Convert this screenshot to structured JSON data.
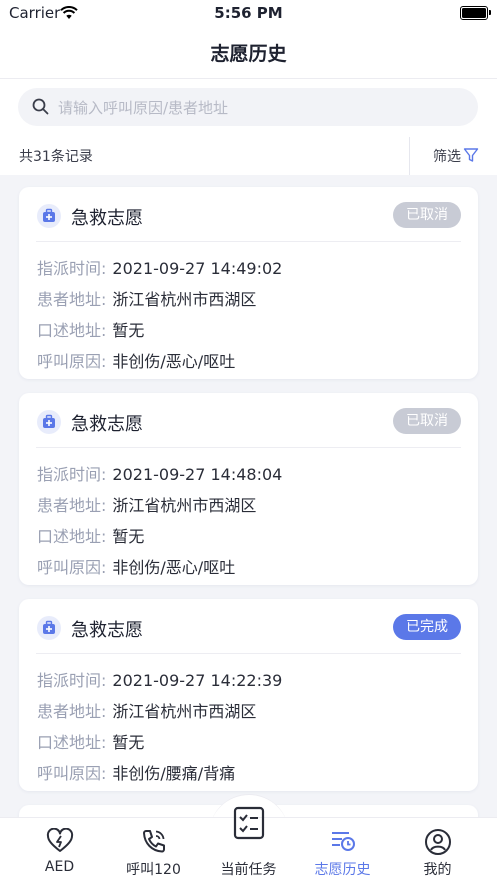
{
  "status_bar": {
    "carrier": "Carrier",
    "time": "5:56 PM"
  },
  "nav": {
    "title": "志愿历史"
  },
  "search": {
    "placeholder": "请输入呼叫原因/患者地址"
  },
  "summary": {
    "count_text": "共31条记录",
    "filter_label": "筛选"
  },
  "labels": {
    "dispatch_time": "指派时间:",
    "patient_address": "患者地址:",
    "oral_address": "口述地址:",
    "call_reason": "呼叫原因:"
  },
  "records": [
    {
      "title": "急救志愿",
      "status": "已取消",
      "status_color": "#c8cbd5",
      "dispatch_time": "2021-09-27 14:49:02",
      "patient_address": "浙江省杭州市西湖区",
      "oral_address": "暂无",
      "call_reason": "非创伤/恶心/呕吐"
    },
    {
      "title": "急救志愿",
      "status": "已取消",
      "status_color": "#c8cbd5",
      "dispatch_time": "2021-09-27 14:48:04",
      "patient_address": "浙江省杭州市西湖区",
      "oral_address": "暂无",
      "call_reason": "非创伤/恶心/呕吐"
    },
    {
      "title": "急救志愿",
      "status": "已完成",
      "status_color": "#5b78e8",
      "dispatch_time": "2021-09-27 14:22:39",
      "patient_address": "浙江省杭州市西湖区",
      "oral_address": "暂无",
      "call_reason": "非创伤/腰痛/背痛"
    }
  ],
  "tabs": [
    {
      "label": "AED",
      "icon": "heart-pulse-icon"
    },
    {
      "label": "呼叫120",
      "icon": "phone-call-icon"
    },
    {
      "label": "当前任务",
      "icon": "task-list-icon"
    },
    {
      "label": "志愿历史",
      "icon": "history-list-icon",
      "active": true
    },
    {
      "label": "我的",
      "icon": "profile-icon"
    }
  ],
  "colors": {
    "accent": "#5b78e8",
    "cancel_badge": "#c8cbd5",
    "background": "#f3f4f8"
  }
}
